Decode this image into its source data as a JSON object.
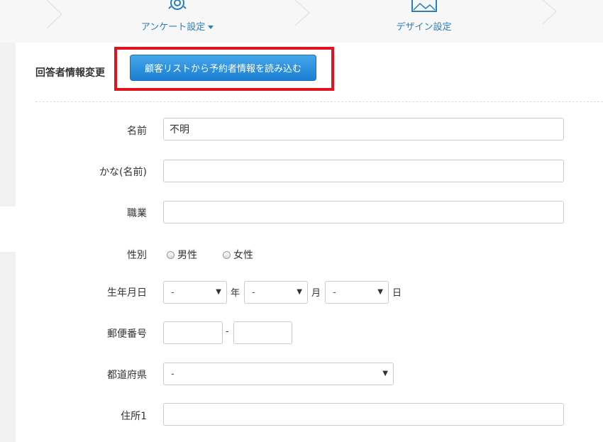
{
  "topnav": {
    "steps": [
      {
        "label": "アンケート設定",
        "icon": "gear-icon"
      },
      {
        "label": "デザイン設定",
        "icon": "image-icon"
      }
    ]
  },
  "section": {
    "title": "回答者情報変更",
    "import_button": "顧客リストから予約者情報を読み込む"
  },
  "form": {
    "name": {
      "label": "名前",
      "value": "不明"
    },
    "kana": {
      "label": "かな(名前)",
      "value": ""
    },
    "job": {
      "label": "職業",
      "value": ""
    },
    "gender": {
      "label": "性別",
      "options": [
        "男性",
        "女性"
      ]
    },
    "birthday": {
      "label": "生年月日",
      "year": "-",
      "month": "-",
      "day": "-",
      "year_unit": "年",
      "month_unit": "月",
      "day_unit": "日"
    },
    "postal": {
      "label": "郵便番号",
      "part1": "",
      "part2": "",
      "separator": "-"
    },
    "prefecture": {
      "label": "都道府県",
      "value": "-"
    },
    "address1": {
      "label": "住所1",
      "value": ""
    }
  },
  "colors": {
    "accent": "#2a7fc0",
    "button": "#1b7fd3",
    "highlight": "#e0141e"
  }
}
